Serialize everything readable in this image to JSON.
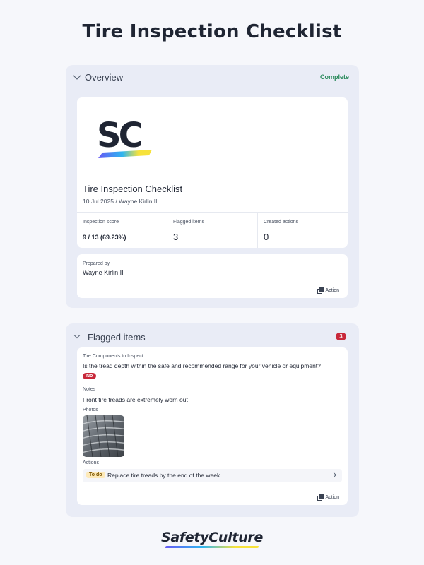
{
  "page": {
    "title": "Tire Inspection Checklist"
  },
  "overview": {
    "title": "Overview",
    "status": "Complete",
    "report": {
      "logo_text": "SC",
      "title": "Tire Inspection Checklist",
      "meta": "10 Jul 2025 / Wayne Kirlin II"
    },
    "stats": [
      {
        "label": "Inspection score",
        "value": "9 / 13 (69.23%)"
      },
      {
        "label": "Flagged items",
        "value": "3"
      },
      {
        "label": "Created actions",
        "value": "0"
      }
    ],
    "prepared_by": {
      "label": "Prepared by",
      "name": "Wayne Kirlin II"
    },
    "action_label": "Action"
  },
  "flagged": {
    "title": "Flagged items",
    "count": "3",
    "item": {
      "category": "Tire Components to Inspect",
      "question": "Is the tread depth within the safe and recommended range for your vehicle or equipment?",
      "answer": "No",
      "notes_label": "Notes",
      "notes": "Front tire treads are extremely worn out",
      "photos_label": "Photos",
      "actions_label": "Actions",
      "action": {
        "status": "To do",
        "text": "Replace tire treads by the end of the week"
      }
    },
    "action_label": "Action"
  },
  "footer": {
    "brand": "SafetyCulture"
  },
  "colors": {
    "section_bg": "#e9ecf6",
    "complete": "#2a8a5c",
    "flag_red": "#c8283a",
    "todo_bg": "#fde9b8"
  }
}
